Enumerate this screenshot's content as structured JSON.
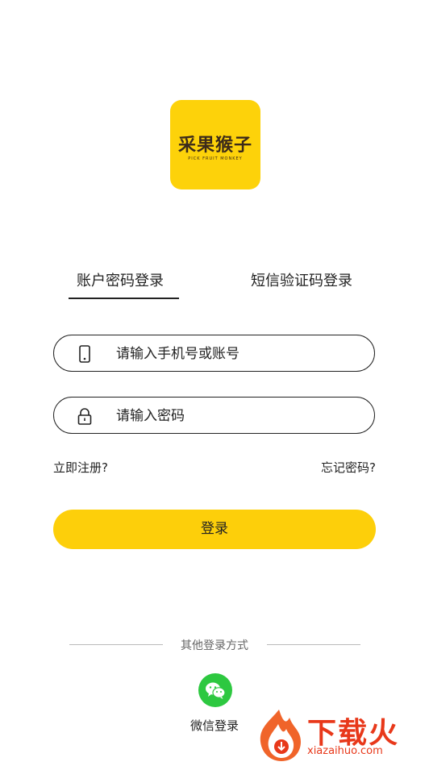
{
  "logo": {
    "text": "采果猴子",
    "subtitle": "PICK FRUIT MONKEY",
    "bg_color": "#fdd20a"
  },
  "tabs": [
    {
      "label": "账户密码登录",
      "active": true
    },
    {
      "label": "短信验证码登录",
      "active": false
    }
  ],
  "form": {
    "phone_placeholder": "请输入手机号或账号",
    "phone_icon": "phone-icon",
    "password_placeholder": "请输入密码",
    "password_icon": "lock-icon"
  },
  "links": {
    "register": "立即注册?",
    "forgot": "忘记密码?"
  },
  "login_button": {
    "label": "登录",
    "color": "#fdcf0a"
  },
  "other_login": {
    "label": "其他登录方式",
    "wechat_label": "微信登录",
    "wechat_icon": "wechat-icon",
    "wechat_color": "#2dc840"
  },
  "watermark": {
    "title": "下载火",
    "url": "xiazaihuo.com",
    "color": "#e8381a"
  }
}
